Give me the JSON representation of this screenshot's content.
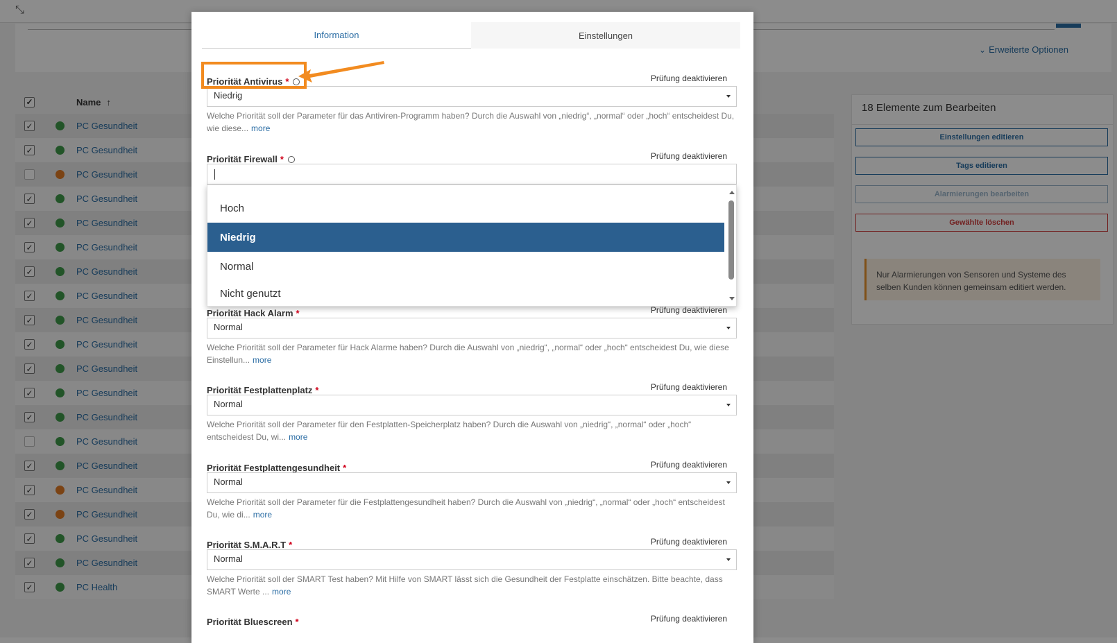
{
  "background": {
    "advanced_options": "Erweiterte Optionen",
    "table": {
      "header_name": "Name",
      "rows": [
        {
          "name": "PC Gesundheit",
          "checked": true,
          "status": "green"
        },
        {
          "name": "PC Gesundheit",
          "checked": true,
          "status": "green"
        },
        {
          "name": "PC Gesundheit",
          "checked": false,
          "status": "orange"
        },
        {
          "name": "PC Gesundheit",
          "checked": true,
          "status": "green"
        },
        {
          "name": "PC Gesundheit",
          "checked": true,
          "status": "green"
        },
        {
          "name": "PC Gesundheit",
          "checked": true,
          "status": "green"
        },
        {
          "name": "PC Gesundheit",
          "checked": true,
          "status": "green"
        },
        {
          "name": "PC Gesundheit",
          "checked": true,
          "status": "green"
        },
        {
          "name": "PC Gesundheit",
          "checked": true,
          "status": "green"
        },
        {
          "name": "PC Gesundheit",
          "checked": true,
          "status": "green"
        },
        {
          "name": "PC Gesundheit",
          "checked": true,
          "status": "green"
        },
        {
          "name": "PC Gesundheit",
          "checked": true,
          "status": "green"
        },
        {
          "name": "PC Gesundheit",
          "checked": true,
          "status": "green"
        },
        {
          "name": "PC Gesundheit",
          "checked": false,
          "status": "green"
        },
        {
          "name": "PC Gesundheit",
          "checked": true,
          "status": "green"
        },
        {
          "name": "PC Gesundheit",
          "checked": true,
          "status": "orange"
        },
        {
          "name": "PC Gesundheit",
          "checked": true,
          "status": "orange"
        },
        {
          "name": "PC Gesundheit",
          "checked": true,
          "status": "green"
        },
        {
          "name": "PC Gesundheit",
          "checked": true,
          "status": "green"
        },
        {
          "name": "PC Health",
          "checked": true,
          "status": "green"
        }
      ]
    },
    "side_panel": {
      "title": "18 Elemente zum Bearbeiten",
      "btn_settings": "Einstellungen editieren",
      "btn_tags": "Tags editieren",
      "btn_alarms": "Alarmierungen bearbeiten",
      "btn_delete": "Gewählte löschen",
      "note": "Nur Alarmierungen von Sensoren und Systeme des selben Kunden können gemeinsam editiert werden."
    }
  },
  "modal": {
    "tabs": [
      {
        "label": "Information",
        "active": true
      },
      {
        "label": "Einstellungen",
        "active": false
      }
    ],
    "disable_label": "Prüfung deaktivieren",
    "more_label": "more",
    "fields": {
      "antivirus": {
        "label": "Priorität Antivirus",
        "value": "Niedrig",
        "desc": "Welche Priorität soll der Parameter für das Antiviren-Programm haben? Durch die Auswahl von „niedrig“, „normal“ oder „hoch“ entscheidest Du, wie diese..."
      },
      "firewall": {
        "label": "Priorität Firewall",
        "options": [
          "Hoch",
          "Niedrig",
          "Normal",
          "Nicht genutzt"
        ],
        "selected": "Niedrig"
      },
      "hack": {
        "label": "Priorität Hack Alarm",
        "value": "Normal",
        "desc": "Welche Priorität soll der Parameter für Hack Alarme haben? Durch die Auswahl von „niedrig“, „normal“ oder „hoch“ entscheidest Du, wie diese Einstellun..."
      },
      "disk_space": {
        "label": "Priorität Festplattenplatz",
        "value": "Normal",
        "desc": "Welche Priorität soll der Parameter für den Festplatten-Speicherplatz haben? Durch die Auswahl von „niedrig“, „normal“ oder „hoch“ entscheidest Du, wi..."
      },
      "disk_health": {
        "label": "Priorität Festplattengesundheit",
        "value": "Normal",
        "desc": "Welche Priorität soll der Parameter für die Festplattengesundheit haben? Durch die Auswahl von „niedrig“, „normal“ oder „hoch“ entscheidest Du, wie di..."
      },
      "smart": {
        "label": "Priorität S.M.A.R.T",
        "value": "Normal",
        "desc": "Welche Priorität soll der SMART Test haben? Mit Hilfe von SMART lässt sich die Gesundheit der Festplatte einschätzen. Bitte beachte, dass SMART Werte ..."
      },
      "bluescreen": {
        "label": "Priorität Bluescreen"
      }
    }
  },
  "colors": {
    "accent": "#2b6da4",
    "highlight": "#f28b20",
    "status_green": "#3f9a4a",
    "status_orange": "#e07b26",
    "required": "#d0021b"
  }
}
